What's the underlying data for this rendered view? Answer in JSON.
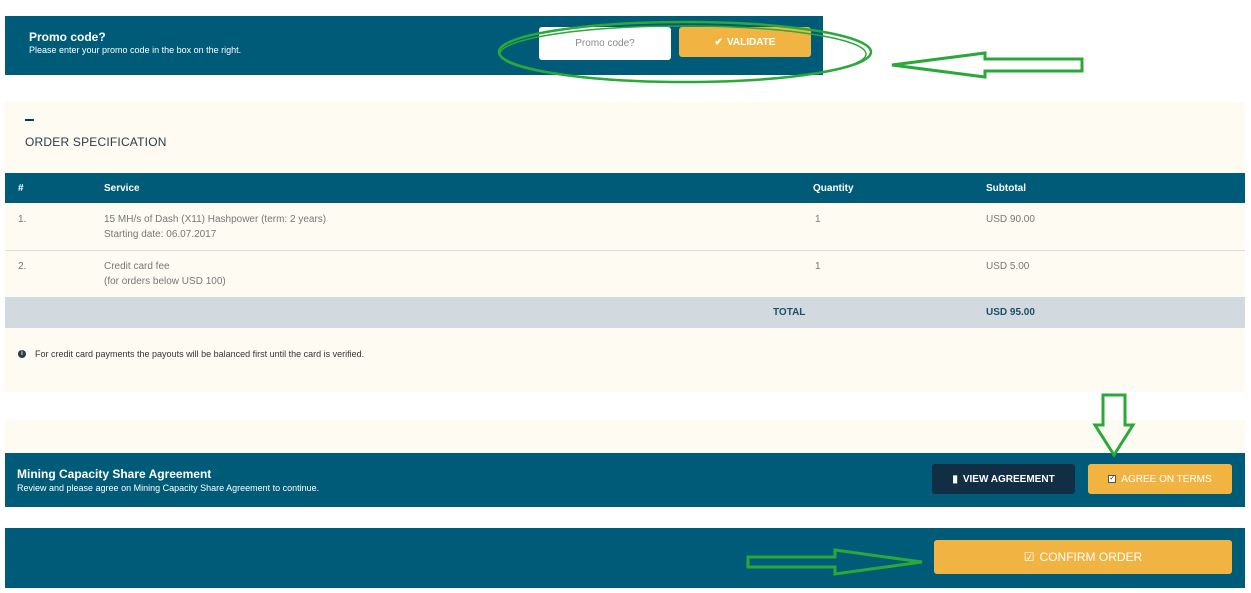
{
  "promo": {
    "title": "Promo code?",
    "subtitle": "Please enter your promo code in the box on the right.",
    "input_placeholder": "Promo code?",
    "input_value": "",
    "validate_icon": "check-icon",
    "validate_label": "VALIDATE"
  },
  "order": {
    "heading": "ORDER SPECIFICATION",
    "columns": [
      "#",
      "Service",
      "Quantity",
      "Subtotal"
    ],
    "rows": [
      {
        "num": "1.",
        "service_line1": "15  MH/s of Dash (X11) Hashpower (term: 2 years)",
        "service_line2": "Starting date: 06.07.2017",
        "quantity": "1",
        "subtotal": "USD 90.00"
      },
      {
        "num": "2.",
        "service_line1": "Credit card fee",
        "service_line2": "(for orders below USD 100)",
        "quantity": "1",
        "subtotal": "USD 5.00"
      }
    ],
    "total_label": "TOTAL",
    "total_value": "USD 95.00",
    "info_icon": "info-icon",
    "info_text": "For credit card payments the payouts will be balanced first until the card is verified."
  },
  "agreement": {
    "title": "Mining Capacity Share Agreement",
    "subtitle": "Review and please agree on Mining Capacity Share Agreement to continue.",
    "view_icon": "book-icon",
    "view_label": "VIEW AGREEMENT",
    "agree_label": "AGREE ON TERMS",
    "agree_checked": true
  },
  "confirm": {
    "icon": "check-square-icon",
    "label": "CONFIRM ORDER"
  },
  "colors": {
    "primary": "#005b78",
    "accent": "#f1b443",
    "dark_button": "#122e45",
    "panel_bg": "#fefbf3",
    "total_bg": "#d2d9df",
    "annotation": "#2aa83a"
  }
}
